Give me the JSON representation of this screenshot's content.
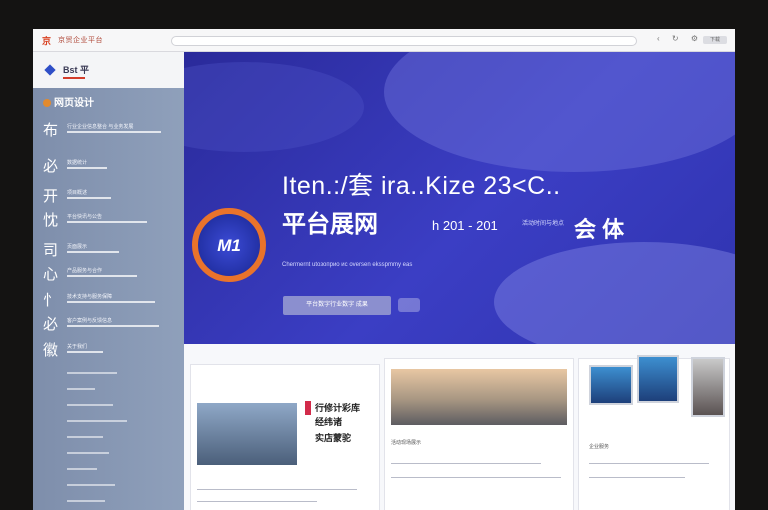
{
  "browser": {
    "logo": "京",
    "brand": "京贸企业平台",
    "button": "下载",
    "icons": [
      "back-icon",
      "refresh-icon",
      "settings-icon"
    ]
  },
  "sidebar": {
    "brand": "Bst 平",
    "top_item": "网页设计",
    "items": [
      {
        "glyph": "布",
        "text": "行业企业信息整合 与业务发展"
      },
      {
        "glyph": "必",
        "text": "数据统计"
      },
      {
        "glyph": "开",
        "text": "项目概述"
      },
      {
        "glyph": "忱",
        "text": "平台快讯与公告"
      },
      {
        "glyph": "司",
        "text": "页面展示"
      },
      {
        "glyph": "心",
        "text": "产品服务与合作"
      },
      {
        "glyph": "忄",
        "text": "技术支持与服务保障"
      },
      {
        "glyph": "必",
        "text": "客户案例与反馈信息"
      },
      {
        "glyph": "徽",
        "text": "关于我们"
      }
    ]
  },
  "hero": {
    "emblem": "M1",
    "title": "Iten.:/套  ira..Kizе 23<C..",
    "subtitle": "平台展网",
    "date": "һ 201 - 201",
    "date_sub": "活动时间与地点",
    "right": "会 体",
    "desc": "Chermernt utoзоприо ис oversen eksspmmy eas",
    "button": "平台数字行业数字 成果"
  },
  "cards": [
    {
      "title1": "行修计彩库",
      "title2": "经纬诸",
      "title3": "实店蒙驼"
    },
    {
      "text": "活动现场展示"
    },
    {
      "text": "企业服务"
    }
  ]
}
